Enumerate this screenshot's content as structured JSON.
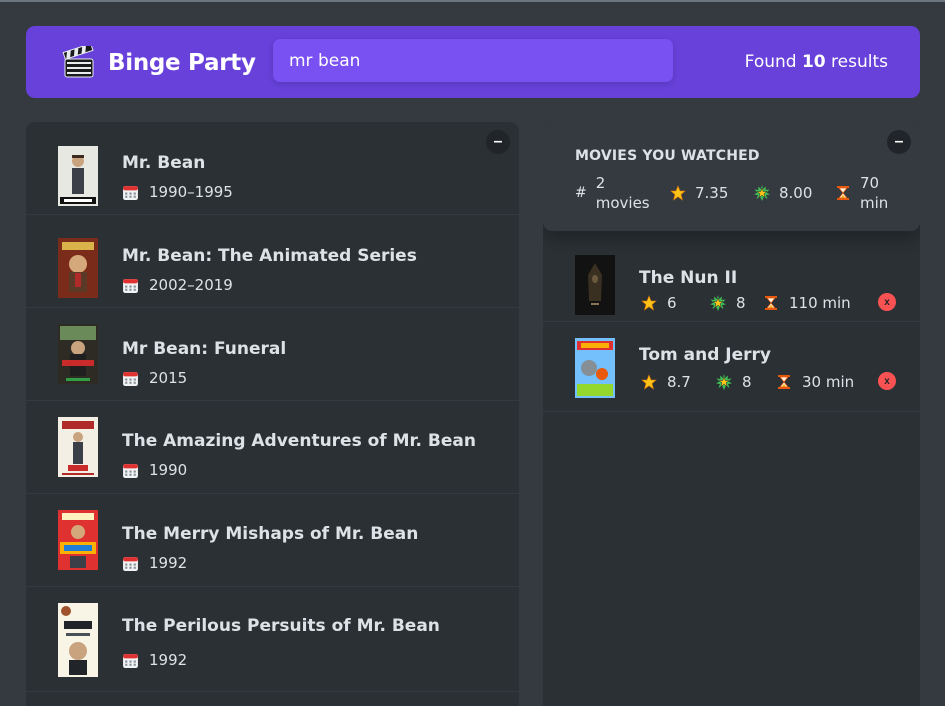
{
  "app": {
    "title": "Binge Party",
    "logo_icon": "clapperboard-icon"
  },
  "search": {
    "value": "mr bean"
  },
  "results": {
    "prefix": "Found ",
    "count": "10",
    "suffix": " results"
  },
  "list_toggle": "–",
  "movies": [
    {
      "title": "Mr. Bean",
      "year": "1990–1995"
    },
    {
      "title": "Mr. Bean: The Animated Series",
      "year": "2002–2019"
    },
    {
      "title": "Mr Bean: Funeral",
      "year": "2015"
    },
    {
      "title": "The Amazing Adventures of Mr. Bean",
      "year": "1990"
    },
    {
      "title": "The Merry Mishaps of Mr. Bean",
      "year": "1992"
    },
    {
      "title": "The Perilous Persuits of Mr. Bean",
      "year": "1992"
    }
  ],
  "watched_toggle": "–",
  "summary": {
    "heading": "MOVIES YOU WATCHED",
    "count_symbol": "#",
    "count_num": "2",
    "count_unit": "movies",
    "avg_imdb": "7.35",
    "avg_user": "8.00",
    "runtime_num": "70",
    "runtime_unit": "min"
  },
  "watched": [
    {
      "title": "The Nun II",
      "imdb": "6",
      "user": "8",
      "runtime": "110 min"
    },
    {
      "title": "Tom and Jerry",
      "imdb": "8.7",
      "user": "8",
      "runtime": "30 min"
    }
  ],
  "delete_label": "x",
  "colors": {
    "accent": "#6741d9",
    "search_bg": "#7950f2",
    "panel": "#2b3035",
    "background": "#343a40",
    "delete": "#fa5252"
  }
}
